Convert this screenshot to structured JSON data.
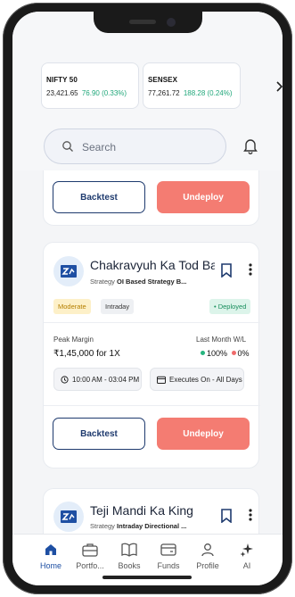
{
  "indices": [
    {
      "name": "NIFTY 50",
      "value": "23,421.65",
      "change": "76.90 (0.33%)"
    },
    {
      "name": "SENSEX",
      "value": "77,261.72",
      "change": "188.28 (0.24%)"
    }
  ],
  "search": {
    "placeholder": "Search"
  },
  "top_card": {
    "backtest_label": "Backtest",
    "undeploy_label": "Undeploy"
  },
  "strategy_main": {
    "title": "Chakravyuh Ka Tod Ba...",
    "strategy_label": "Strategy",
    "strategy_value": "OI Based Strategy B...",
    "tags": {
      "risk": "Moderate",
      "type": "Intraday",
      "status": "• Deployed"
    },
    "peak_margin_label": "Peak Margin",
    "peak_margin_value": "₹1,45,000 for 1X",
    "wl_label": "Last Month W/L",
    "win": "100%",
    "loss": "0%",
    "time_chip": "10:00 AM - 03:04 PM",
    "days_chip": "Executes On - All Days",
    "backtest_label": "Backtest",
    "undeploy_label": "Undeploy"
  },
  "strategy_next": {
    "title": "Teji Mandi Ka King",
    "strategy_label": "Strategy",
    "strategy_value": "Intraday Directional ..."
  },
  "nav": [
    {
      "label": "Home",
      "icon": "home-icon"
    },
    {
      "label": "Portfo...",
      "icon": "briefcase-icon"
    },
    {
      "label": "Books",
      "icon": "book-icon"
    },
    {
      "label": "Funds",
      "icon": "wallet-icon"
    },
    {
      "label": "Profile",
      "icon": "person-icon"
    },
    {
      "label": "AI",
      "icon": "sparkle-icon"
    }
  ],
  "colors": {
    "accent": "#1e4fa3",
    "positive": "#20a77a",
    "undeploy": "#f47c72",
    "deployed_bg": "#dcf4ea"
  }
}
